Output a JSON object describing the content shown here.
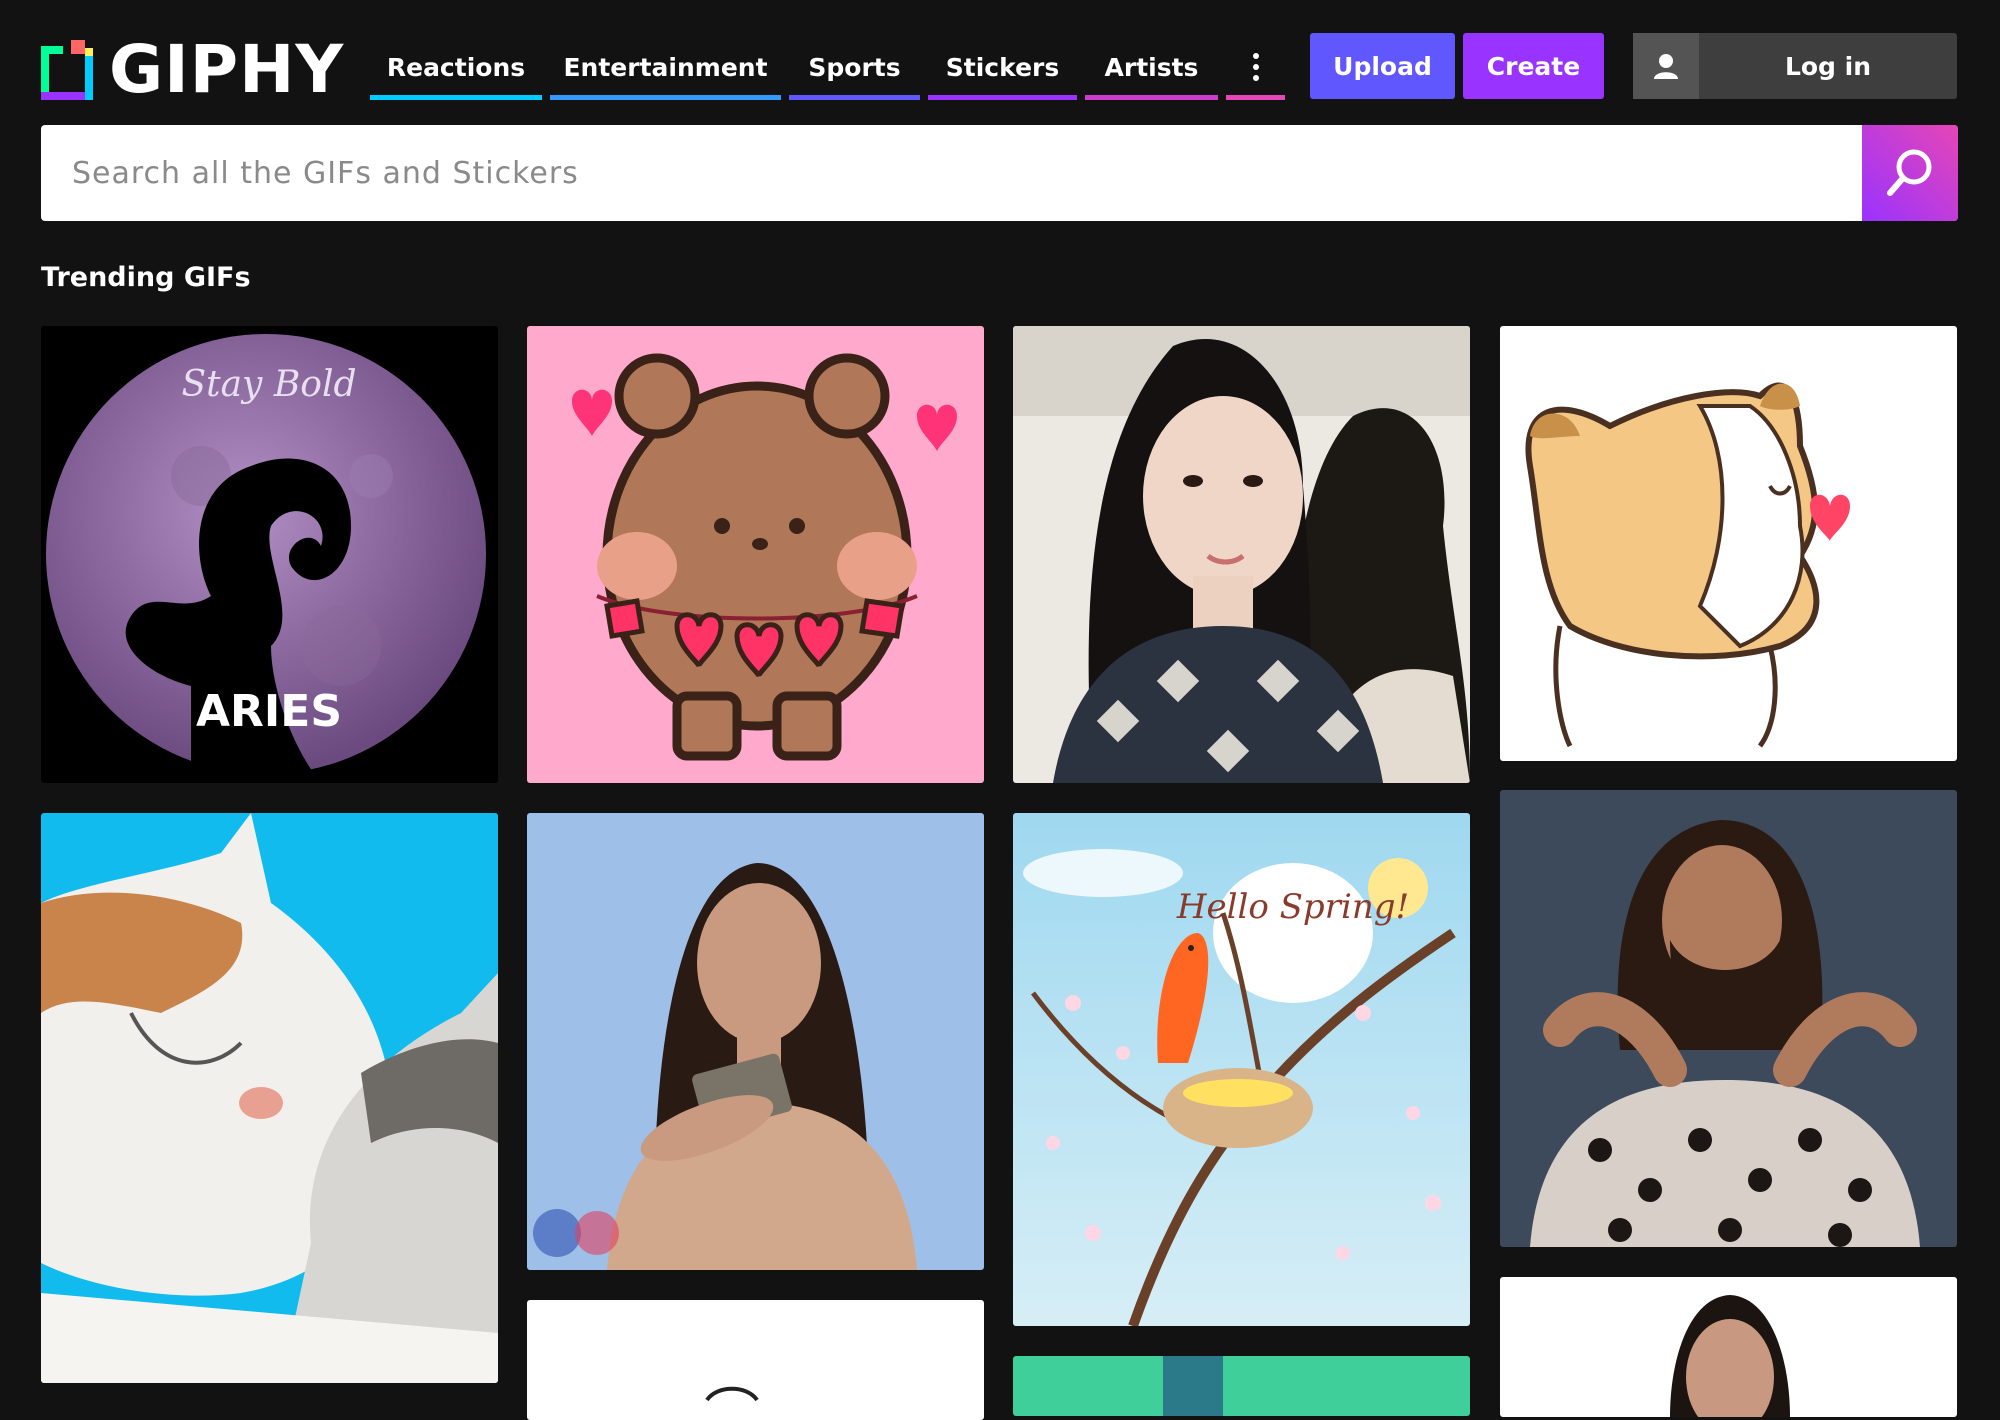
{
  "brand": {
    "name": "GIPHY"
  },
  "nav": {
    "items": [
      {
        "label": "Reactions",
        "color": "#00ccff"
      },
      {
        "label": "Entertainment",
        "color": "#3399ff"
      },
      {
        "label": "Sports",
        "color": "#6157ff"
      },
      {
        "label": "Stickers",
        "color": "#9933ff"
      },
      {
        "label": "Artists",
        "color": "#cc3dcc"
      }
    ],
    "more_color": "#e646b6"
  },
  "actions": {
    "upload": "Upload",
    "create": "Create",
    "login": "Log in"
  },
  "search": {
    "placeholder": "Search all the GIFs and Stickers"
  },
  "trending": {
    "title": "Trending GIFs",
    "items": [
      {
        "caption_top": "Stay Bold",
        "caption_bottom": "ARIES"
      },
      {
        "caption": ""
      },
      {
        "caption": ""
      },
      {
        "caption": ""
      },
      {
        "caption": ""
      },
      {
        "caption": ""
      },
      {
        "caption": "Hello Spring!"
      },
      {
        "caption": ""
      }
    ]
  }
}
